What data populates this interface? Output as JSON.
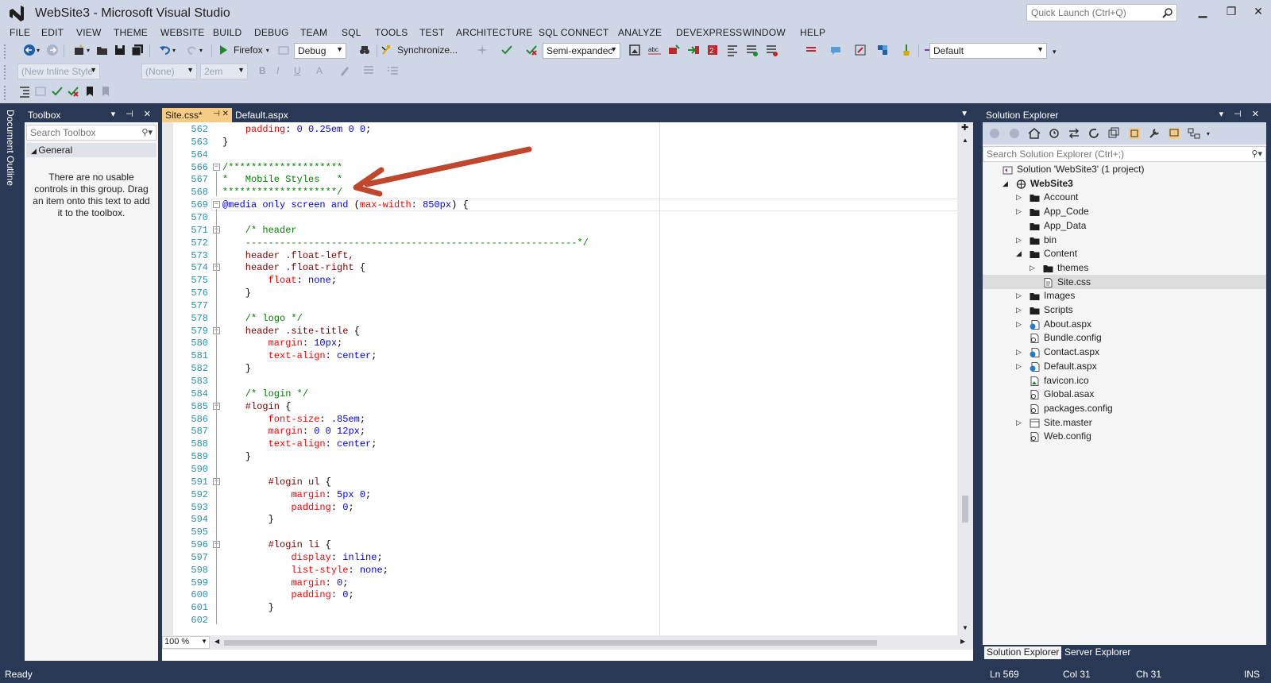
{
  "window": {
    "title": "WebSite3 - Microsoft Visual Studio",
    "quick_launch_placeholder": "Quick Launch (Ctrl+Q)",
    "minimize": "▁",
    "maximize": "❐",
    "close": "✕"
  },
  "menu": [
    "FILE",
    "EDIT",
    "VIEW",
    "THEME",
    "WEBSITE",
    "BUILD",
    "DEBUG",
    "TEAM",
    "SQL",
    "TOOLS",
    "TEST",
    "ARCHITECTURE",
    "SQL CONNECT",
    "ANALYZE",
    "DEVEXPRESS",
    "WINDOW",
    "HELP"
  ],
  "toolbar": {
    "browser_label": "Firefox",
    "config_value": "Debug",
    "synchronize_label": "Synchronize...",
    "outline_value": "Semi-expandec",
    "layout_value": "Default",
    "style_value": "(New Inline Style",
    "font_value": "(None)",
    "size_value": "2em",
    "bold": "B",
    "italic": "I",
    "underline": "U"
  },
  "doc_outline_label": "Document Outline",
  "toolbox": {
    "title": "Toolbox",
    "search_placeholder": "Search Toolbox",
    "group": "General",
    "empty_message": "There are no usable controls in this group. Drag an item onto this text to add it to the toolbox."
  },
  "editor": {
    "tabs": [
      {
        "label": "Site.css*",
        "pin": "⊣ ✕"
      },
      {
        "label": "Default.aspx"
      }
    ],
    "zoom": "100 %",
    "lines": [
      {
        "n": "562",
        "segs": [
          [
            "    ",
            "pl"
          ],
          [
            "padding",
            "prop"
          ],
          [
            ": ",
            "pl"
          ],
          [
            "0 0.25em 0 0",
            "val"
          ],
          [
            ";",
            "pl"
          ]
        ]
      },
      {
        "n": "563",
        "segs": [
          [
            "}",
            "pl"
          ]
        ]
      },
      {
        "n": "564",
        "segs": []
      },
      {
        "n": "566",
        "segs": [
          [
            "/********************",
            "com"
          ]
        ],
        "fold": "−"
      },
      {
        "n": "567",
        "segs": [
          [
            "*   Mobile Styles   *",
            "com"
          ]
        ]
      },
      {
        "n": "568",
        "segs": [
          [
            "********************/",
            "com"
          ]
        ]
      },
      {
        "n": "569",
        "segs": [
          [
            "@media only screen and ",
            "kw"
          ],
          [
            "(",
            "pl"
          ],
          [
            "max-width",
            "prop"
          ],
          [
            ": ",
            "pl"
          ],
          [
            "850px",
            "val"
          ],
          [
            ") {",
            "pl"
          ]
        ],
        "fold": "−"
      },
      {
        "n": "570",
        "segs": []
      },
      {
        "n": "571",
        "segs": [
          [
            "    /* header",
            "com"
          ]
        ],
        "fold": "−"
      },
      {
        "n": "572",
        "segs": [
          [
            "    ----------------------------------------------------------*/",
            "com"
          ]
        ]
      },
      {
        "n": "573",
        "segs": [
          [
            "    header .float-left,",
            "sel"
          ]
        ]
      },
      {
        "n": "574",
        "segs": [
          [
            "    header .float-right ",
            "sel"
          ],
          [
            "{",
            "pl"
          ]
        ],
        "fold": "−"
      },
      {
        "n": "575",
        "segs": [
          [
            "        float",
            "prop"
          ],
          [
            ": ",
            "pl"
          ],
          [
            "none",
            "val"
          ],
          [
            ";",
            "pl"
          ]
        ]
      },
      {
        "n": "576",
        "segs": [
          [
            "    }",
            "pl"
          ]
        ]
      },
      {
        "n": "577",
        "segs": []
      },
      {
        "n": "578",
        "segs": [
          [
            "    /* logo */",
            "com"
          ]
        ]
      },
      {
        "n": "579",
        "segs": [
          [
            "    header .site-title ",
            "sel"
          ],
          [
            "{",
            "pl"
          ]
        ],
        "fold": "−"
      },
      {
        "n": "580",
        "segs": [
          [
            "        margin",
            "prop"
          ],
          [
            ": ",
            "pl"
          ],
          [
            "10px",
            "val"
          ],
          [
            ";",
            "pl"
          ]
        ]
      },
      {
        "n": "581",
        "segs": [
          [
            "        text-align",
            "prop"
          ],
          [
            ": ",
            "pl"
          ],
          [
            "center",
            "val"
          ],
          [
            ";",
            "pl"
          ]
        ]
      },
      {
        "n": "582",
        "segs": [
          [
            "    }",
            "pl"
          ]
        ]
      },
      {
        "n": "583",
        "segs": []
      },
      {
        "n": "584",
        "segs": [
          [
            "    /* login */",
            "com"
          ]
        ]
      },
      {
        "n": "585",
        "segs": [
          [
            "    #login ",
            "sel"
          ],
          [
            "{",
            "pl"
          ]
        ],
        "fold": "−"
      },
      {
        "n": "586",
        "segs": [
          [
            "        font-size",
            "prop"
          ],
          [
            ": ",
            "pl"
          ],
          [
            ".85em",
            "val"
          ],
          [
            ";",
            "pl"
          ]
        ]
      },
      {
        "n": "587",
        "segs": [
          [
            "        margin",
            "prop"
          ],
          [
            ": ",
            "pl"
          ],
          [
            "0 0 12px",
            "val"
          ],
          [
            ";",
            "pl"
          ]
        ]
      },
      {
        "n": "588",
        "segs": [
          [
            "        text-align",
            "prop"
          ],
          [
            ": ",
            "pl"
          ],
          [
            "center",
            "val"
          ],
          [
            ";",
            "pl"
          ]
        ]
      },
      {
        "n": "589",
        "segs": [
          [
            "    }",
            "pl"
          ]
        ]
      },
      {
        "n": "590",
        "segs": []
      },
      {
        "n": "591",
        "segs": [
          [
            "        #login ul ",
            "sel"
          ],
          [
            "{",
            "pl"
          ]
        ],
        "fold": "−"
      },
      {
        "n": "592",
        "segs": [
          [
            "            margin",
            "prop"
          ],
          [
            ": ",
            "pl"
          ],
          [
            "5px 0",
            "val"
          ],
          [
            ";",
            "pl"
          ]
        ]
      },
      {
        "n": "593",
        "segs": [
          [
            "            padding",
            "prop"
          ],
          [
            ": ",
            "pl"
          ],
          [
            "0",
            "val"
          ],
          [
            ";",
            "pl"
          ]
        ]
      },
      {
        "n": "594",
        "segs": [
          [
            "        }",
            "pl"
          ]
        ]
      },
      {
        "n": "595",
        "segs": []
      },
      {
        "n": "596",
        "segs": [
          [
            "        #login li ",
            "sel"
          ],
          [
            "{",
            "pl"
          ]
        ],
        "fold": "−"
      },
      {
        "n": "597",
        "segs": [
          [
            "            display",
            "prop"
          ],
          [
            ": ",
            "pl"
          ],
          [
            "inline",
            "val"
          ],
          [
            ";",
            "pl"
          ]
        ]
      },
      {
        "n": "598",
        "segs": [
          [
            "            list-style",
            "prop"
          ],
          [
            ": ",
            "pl"
          ],
          [
            "none",
            "val"
          ],
          [
            ";",
            "pl"
          ]
        ]
      },
      {
        "n": "599",
        "segs": [
          [
            "            margin",
            "prop"
          ],
          [
            ": ",
            "pl"
          ],
          [
            "0",
            "val"
          ],
          [
            ";",
            "pl"
          ]
        ]
      },
      {
        "n": "600",
        "segs": [
          [
            "            padding",
            "prop"
          ],
          [
            ": ",
            "pl"
          ],
          [
            "0",
            "val"
          ],
          [
            ";",
            "pl"
          ]
        ]
      },
      {
        "n": "601",
        "segs": [
          [
            "        }",
            "pl"
          ]
        ]
      },
      {
        "n": "602",
        "segs": []
      }
    ]
  },
  "solution_explorer": {
    "title": "Solution Explorer",
    "search_placeholder": "Search Solution Explorer (Ctrl+;)",
    "tree": [
      {
        "label": "Solution 'WebSite3' (1 project)",
        "depth": 0,
        "icon": "solution-icon",
        "exp": ""
      },
      {
        "label": "WebSite3",
        "depth": 1,
        "icon": "globe-icon",
        "exp": "◢",
        "bold": true
      },
      {
        "label": "Account",
        "depth": 2,
        "icon": "folder-icon",
        "exp": "▷"
      },
      {
        "label": "App_Code",
        "depth": 2,
        "icon": "folder-icon",
        "exp": "▷"
      },
      {
        "label": "App_Data",
        "depth": 2,
        "icon": "folder-icon",
        "exp": ""
      },
      {
        "label": "bin",
        "depth": 2,
        "icon": "folder-icon",
        "exp": "▷"
      },
      {
        "label": "Content",
        "depth": 2,
        "icon": "folder-icon",
        "exp": "◢"
      },
      {
        "label": "themes",
        "depth": 3,
        "icon": "folder-icon",
        "exp": "▷"
      },
      {
        "label": "Site.css",
        "depth": 3,
        "icon": "css-file-icon",
        "exp": "",
        "selected": true
      },
      {
        "label": "Images",
        "depth": 2,
        "icon": "folder-icon",
        "exp": "▷"
      },
      {
        "label": "Scripts",
        "depth": 2,
        "icon": "folder-icon",
        "exp": "▷"
      },
      {
        "label": "About.aspx",
        "depth": 2,
        "icon": "aspx-file-icon",
        "exp": "▷"
      },
      {
        "label": "Bundle.config",
        "depth": 2,
        "icon": "config-file-icon",
        "exp": ""
      },
      {
        "label": "Contact.aspx",
        "depth": 2,
        "icon": "aspx-file-icon",
        "exp": "▷"
      },
      {
        "label": "Default.aspx",
        "depth": 2,
        "icon": "aspx-file-icon",
        "exp": "▷"
      },
      {
        "label": "favicon.ico",
        "depth": 2,
        "icon": "image-file-icon",
        "exp": ""
      },
      {
        "label": "Global.asax",
        "depth": 2,
        "icon": "config-file-icon",
        "exp": ""
      },
      {
        "label": "packages.config",
        "depth": 2,
        "icon": "config-file-icon",
        "exp": ""
      },
      {
        "label": "Site.master",
        "depth": 2,
        "icon": "master-file-icon",
        "exp": "▷"
      },
      {
        "label": "Web.config",
        "depth": 2,
        "icon": "config-file-icon",
        "exp": ""
      }
    ],
    "bottom_tabs": [
      "Solution Explorer",
      "Server Explorer"
    ]
  },
  "status": {
    "ready": "Ready",
    "line": "Ln 569",
    "col": "Col 31",
    "ch": "Ch 31",
    "mode": "INS"
  },
  "colors": {
    "chrome": "#293955",
    "toolbar": "#cfd6e5",
    "active_tab": "#f5cc84",
    "annotation_arrow": "#c0462e"
  }
}
